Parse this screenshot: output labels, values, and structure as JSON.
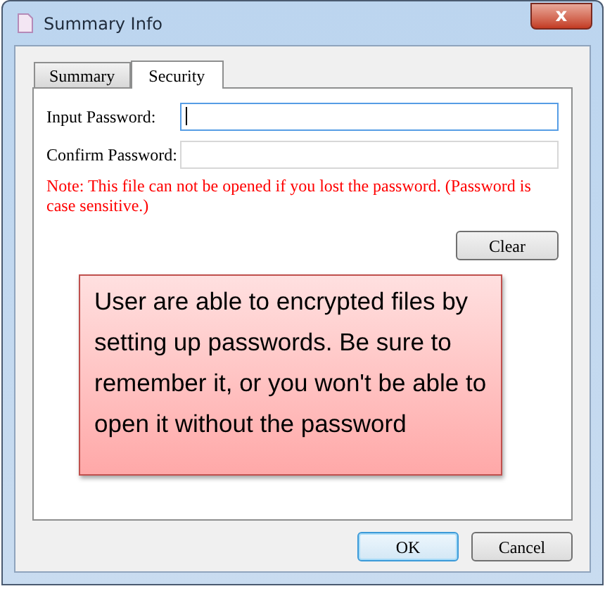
{
  "window": {
    "title": "Summary Info",
    "close_label": "x"
  },
  "tabs": [
    {
      "label": "Summary",
      "selected": false
    },
    {
      "label": "Security",
      "selected": true
    }
  ],
  "fields": [
    {
      "label": "Input Password:",
      "focused": true
    },
    {
      "label": "Confirm Password:",
      "focused": false
    }
  ],
  "note": "Note: This file can not be opened if you lost the password. (Password is case sensitive.)",
  "clear_button": "Clear",
  "callout": "User are able to encrypted files by setting up passwords. Be sure to remember it, or you won't be able to open it without the password",
  "buttons": [
    {
      "label": "OK",
      "default": true
    },
    {
      "label": "Cancel",
      "default": false
    }
  ]
}
